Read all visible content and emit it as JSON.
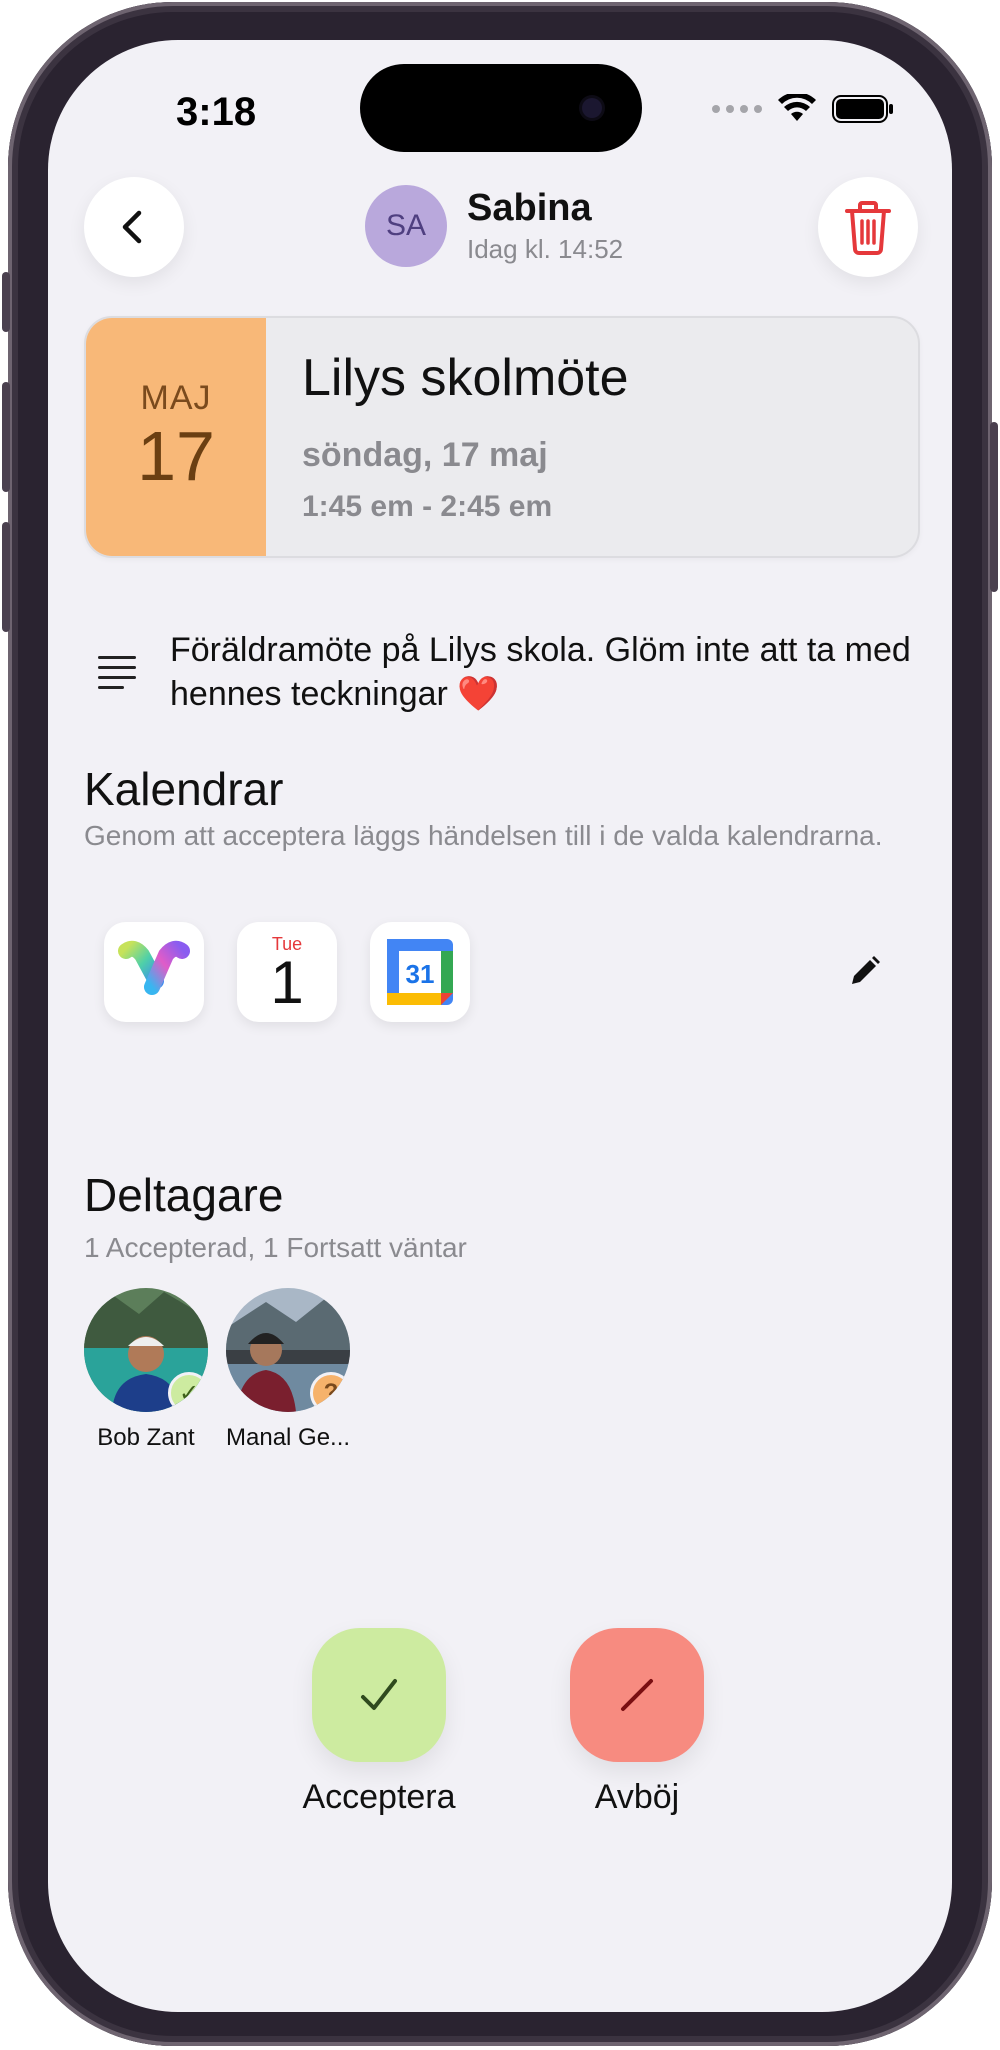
{
  "status_bar": {
    "time": "3:18"
  },
  "header": {
    "sender_initials": "SA",
    "sender_name": "Sabina",
    "sent_time": "Idag kl. 14:52"
  },
  "event": {
    "month": "MAJ",
    "day": "17",
    "title": "Lilys skolmöte",
    "date": "söndag, 17 maj",
    "time": "1:45 em - 2:45 em",
    "description": "Föräldramöte på Lilys skola. Glöm inte att ta med hennes teckningar",
    "description_emoji": "❤️"
  },
  "calendars": {
    "title": "Kalendrar",
    "subtitle": "Genom att acceptera läggs händelsen till i de valda kalendrarna.",
    "apple_calendar_weekday": "Tue",
    "apple_calendar_day": "1",
    "google_calendar_day": "31"
  },
  "participants": {
    "title": "Deltagare",
    "subtitle": "1 Accepterad, 1 Fortsatt väntar",
    "people": [
      {
        "name": "Bob Zant",
        "status": "accepted"
      },
      {
        "name": "Manal Ge...",
        "status": "pending",
        "badge": "?"
      }
    ]
  },
  "actions": {
    "accept_label": "Acceptera",
    "decline_label": "Avböj"
  },
  "colors": {
    "date_block": "#f8b878",
    "accept": "#cdeba0",
    "decline": "#f78b80",
    "trash": "#e5383b",
    "avatar": "#b9a8dc"
  }
}
